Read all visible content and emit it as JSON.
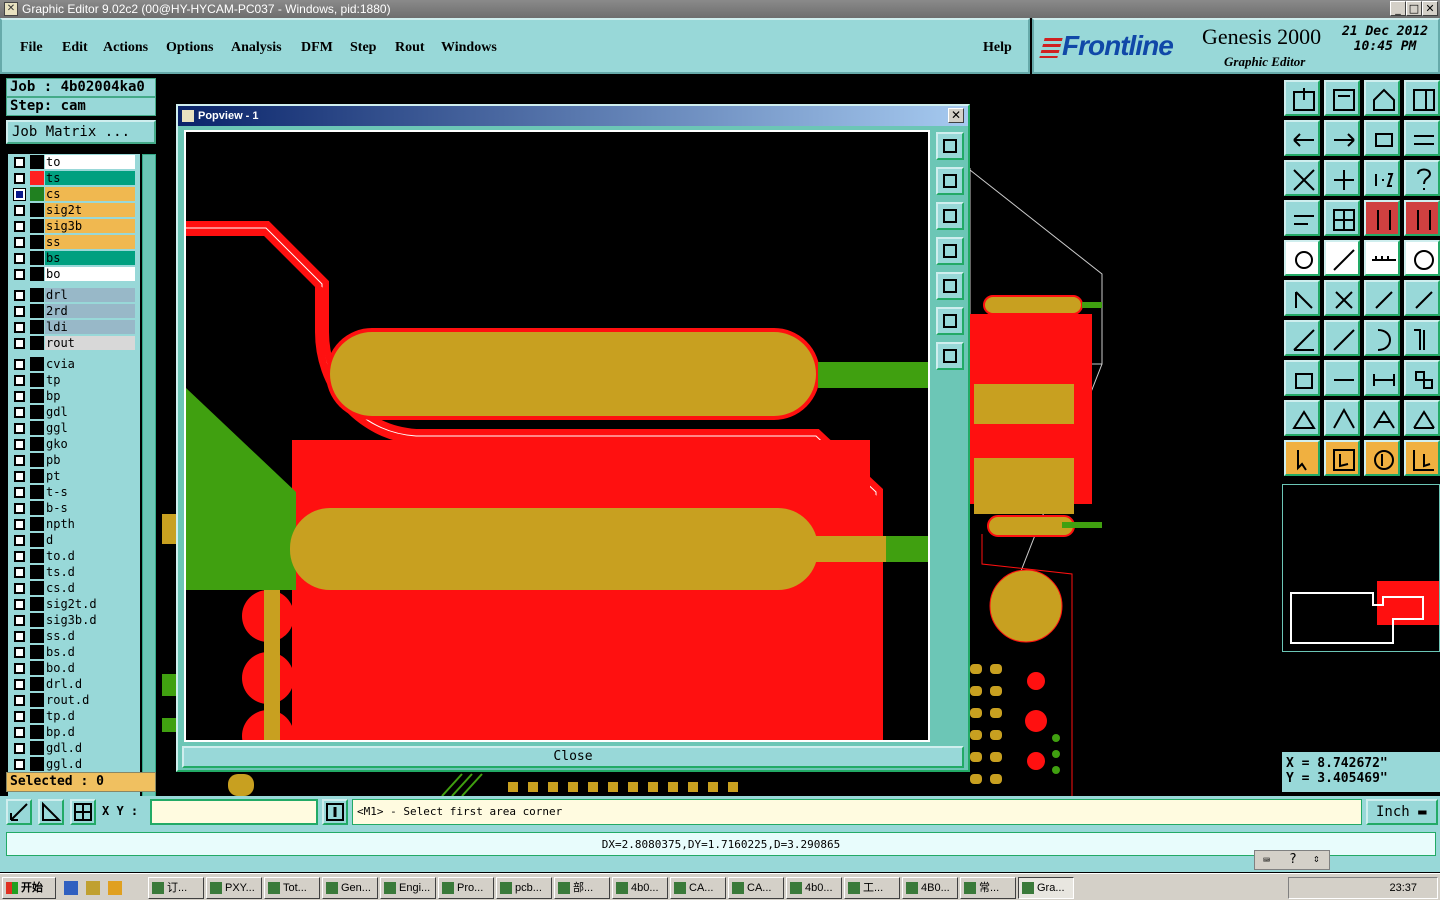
{
  "window": {
    "title": "Graphic Editor 9.02c2 (00@HY-HYCAM-PC037 - Windows, pid:1880)"
  },
  "menu": {
    "items": [
      "File",
      "Edit",
      "Actions",
      "Options",
      "Analysis",
      "DFM",
      "Step",
      "Rout",
      "Windows"
    ],
    "help": "Help"
  },
  "brand": {
    "logo": "Frontline",
    "product": "Genesis 2000",
    "subtitle": "Graphic Editor",
    "date": "21 Dec 2012",
    "time": "10:45 PM"
  },
  "left": {
    "job": "Job : 4b02004ka0",
    "step": "Step: cam",
    "job_matrix": "Job Matrix ...",
    "selected": "Selected : 0",
    "groups": [
      [
        {
          "name": "to",
          "bg": "#ffffff"
        },
        {
          "name": "ts",
          "bg": "#00a080",
          "color": "#ff2020"
        },
        {
          "name": "cs",
          "bg": "#f0b850",
          "color": "#208020",
          "on": true
        },
        {
          "name": "sig2t",
          "bg": "#f0b850"
        },
        {
          "name": "sig3b",
          "bg": "#f0b850"
        },
        {
          "name": "ss",
          "bg": "#f0b850"
        },
        {
          "name": "bs",
          "bg": "#00a080"
        },
        {
          "name": "bo",
          "bg": "#ffffff"
        }
      ],
      [
        {
          "name": "drl",
          "bg": "#98b8c8"
        },
        {
          "name": "2rd",
          "bg": "#98b8c8"
        },
        {
          "name": "ldi",
          "bg": "#98b8c8"
        },
        {
          "name": "rout",
          "bg": "#d8d8d8"
        }
      ],
      [
        {
          "name": "cvia",
          "bg": "#98d8d8"
        },
        {
          "name": "tp",
          "bg": "#98d8d8"
        },
        {
          "name": "bp",
          "bg": "#98d8d8"
        },
        {
          "name": "gdl",
          "bg": "#98d8d8"
        },
        {
          "name": "ggl",
          "bg": "#98d8d8"
        },
        {
          "name": "gko",
          "bg": "#98d8d8"
        },
        {
          "name": "pb",
          "bg": "#98d8d8"
        },
        {
          "name": "pt",
          "bg": "#98d8d8"
        },
        {
          "name": "t-s",
          "bg": "#98d8d8"
        },
        {
          "name": "b-s",
          "bg": "#98d8d8"
        },
        {
          "name": "npth",
          "bg": "#98d8d8"
        },
        {
          "name": "d",
          "bg": "#98d8d8"
        },
        {
          "name": "to.d",
          "bg": "#98d8d8"
        },
        {
          "name": "ts.d",
          "bg": "#98d8d8"
        },
        {
          "name": "cs.d",
          "bg": "#98d8d8"
        },
        {
          "name": "sig2t.d",
          "bg": "#98d8d8"
        },
        {
          "name": "sig3b.d",
          "bg": "#98d8d8"
        },
        {
          "name": "ss.d",
          "bg": "#98d8d8"
        },
        {
          "name": "bs.d",
          "bg": "#98d8d8"
        },
        {
          "name": "bo.d",
          "bg": "#98d8d8"
        },
        {
          "name": "drl.d",
          "bg": "#98d8d8"
        },
        {
          "name": "rout.d",
          "bg": "#98d8d8"
        },
        {
          "name": "tp.d",
          "bg": "#98d8d8"
        },
        {
          "name": "bp.d",
          "bg": "#98d8d8"
        },
        {
          "name": "gdl.d",
          "bg": "#98d8d8"
        },
        {
          "name": "ggl.d",
          "bg": "#98d8d8"
        }
      ]
    ]
  },
  "popview": {
    "title": "Popview - 1",
    "close_label": "Close"
  },
  "coords": {
    "x": "X = 8.742672\"",
    "y": "Y = 3.405469\""
  },
  "command": {
    "xy_label": "X Y :",
    "prompt": "<M1> - Select first area corner",
    "units": "Inch"
  },
  "status": {
    "measure": "DX=2.8080375,DY=1.7160225,D=3.290865"
  },
  "taskbar": {
    "start": "开始",
    "tasks": [
      "订...",
      "PXY...",
      "Tot...",
      "Gen...",
      "Engi...",
      "Pro...",
      "pcb...",
      "部...",
      "4b0...",
      "CA...",
      "CA...",
      "4b0...",
      "工...",
      "4B0...",
      "常...",
      "Gra..."
    ],
    "clock": "23:37"
  },
  "colors": {
    "copper": "#c8a020",
    "red": "#ff1010",
    "green": "#40a010",
    "panel": "#98d8d8"
  }
}
